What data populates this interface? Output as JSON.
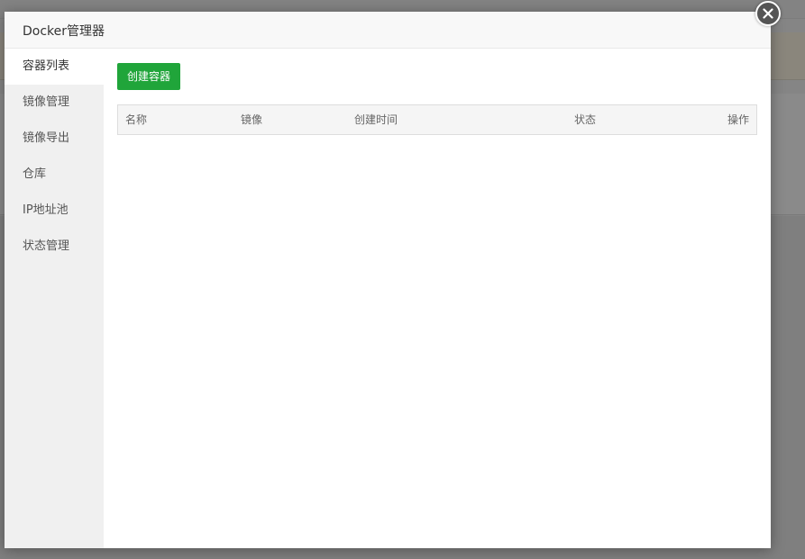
{
  "modal": {
    "title": "Docker管理器"
  },
  "sidebar": {
    "items": [
      {
        "label": "容器列表",
        "active": true
      },
      {
        "label": "镜像管理",
        "active": false
      },
      {
        "label": "镜像导出",
        "active": false
      },
      {
        "label": "仓库",
        "active": false
      },
      {
        "label": "IP地址池",
        "active": false
      },
      {
        "label": "状态管理",
        "active": false
      }
    ]
  },
  "main": {
    "create_button": "创建容器",
    "table": {
      "headers": [
        "名称",
        "镜像",
        "创建时间",
        "状态",
        "操作"
      ],
      "rows": []
    }
  },
  "colors": {
    "accent": "#20a53a",
    "close_button": "#555555"
  },
  "icons": {
    "close": "close-icon"
  }
}
